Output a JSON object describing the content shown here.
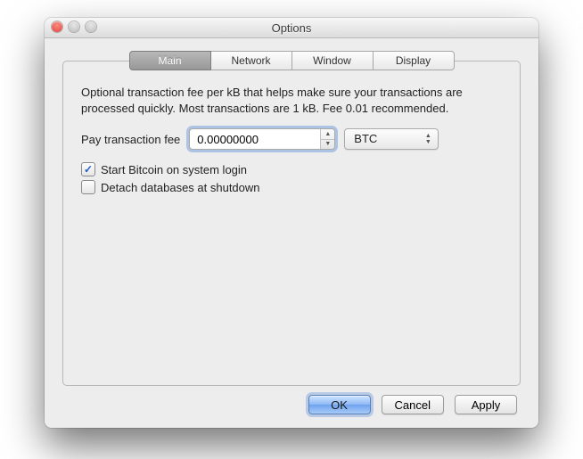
{
  "window": {
    "title": "Options"
  },
  "tabs": [
    {
      "label": "Main",
      "active": true
    },
    {
      "label": "Network",
      "active": false
    },
    {
      "label": "Window",
      "active": false
    },
    {
      "label": "Display",
      "active": false
    }
  ],
  "main": {
    "description": "Optional transaction fee per kB that helps make sure your transactions are processed quickly. Most transactions are 1 kB. Fee 0.01 recommended.",
    "fee_label": "Pay transaction fee",
    "fee_value": "0.00000000",
    "currency_selected": "BTC",
    "checkbox_start_login": {
      "label": "Start Bitcoin on system login",
      "checked": true
    },
    "checkbox_detach_db": {
      "label": "Detach databases at shutdown",
      "checked": false
    }
  },
  "buttons": {
    "ok": "OK",
    "cancel": "Cancel",
    "apply": "Apply"
  }
}
